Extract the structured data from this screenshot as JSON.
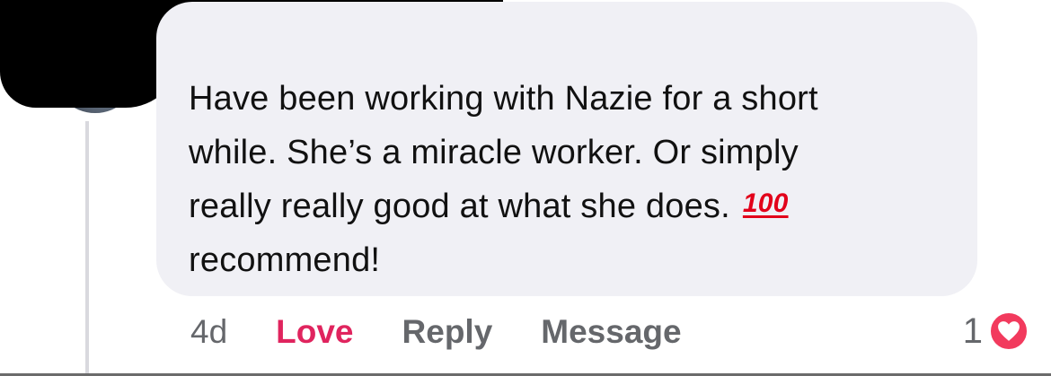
{
  "comment": {
    "lines": [
      "Have been working with Nazie for a short",
      "while. She’s a miracle worker. Or simply",
      "really really good at what she does.",
      "recommend!"
    ],
    "emoji": "💯",
    "emoji_glyph_text": "100"
  },
  "actions": {
    "age": "4d",
    "love": "Love",
    "reply": "Reply",
    "message": "Message"
  },
  "reactions": {
    "count": "1",
    "type": "heart-icon"
  },
  "colors": {
    "bubble": "#f0f0f5",
    "love": "#e0245e",
    "muted": "#65676b",
    "heart": "#f23a5d"
  }
}
